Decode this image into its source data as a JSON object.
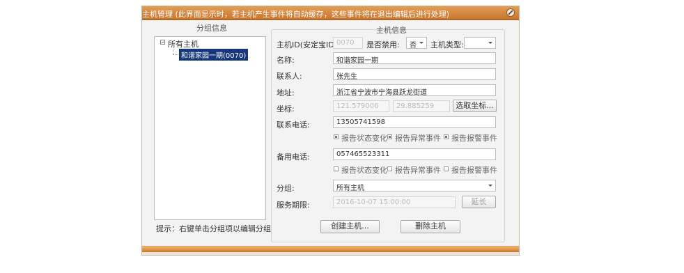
{
  "window": {
    "title": "主机管理  (此界面显示时，若主机产生事件将自动缓存，这些事件将在退出编辑后进行处理)",
    "close_icon": "close-icon"
  },
  "group_panel": {
    "legend": "分组信息",
    "tree": {
      "root_label": "所有主机",
      "child_label": "和谐家园一期(0070)"
    },
    "hint": "提示：右键单击分组项以编辑分组"
  },
  "host_info": {
    "legend": "主机信息",
    "host_id_label": "主机ID(安定宝ID):",
    "host_id_value": "0070",
    "disabled_label": "是否禁用:",
    "disabled_value": "否",
    "host_type_label": "主机类型:",
    "host_type_value": "",
    "name_label": "名称:",
    "name_value": "和谐家园一期",
    "contact_label": "联系人:",
    "contact_value": "张先生",
    "address_label": "地址:",
    "address_value": "浙江省宁波市宁海县跃龙街道",
    "coord_label": "坐标:",
    "coord_lng": "121.579006",
    "coord_lat": "29.885259",
    "pick_coord_button": "选取坐标...",
    "phone_label": "联系电话:",
    "phone_value": "13505741598",
    "phone_options": [
      {
        "label": "报告状态变化",
        "checked": true
      },
      {
        "label": "报告异常事件",
        "checked": true
      },
      {
        "label": "报告报警事件",
        "checked": true
      }
    ],
    "backup_phone_label": "备用电话:",
    "backup_phone_value": "057465523311",
    "backup_options": [
      {
        "label": "报告状态变化",
        "checked": false
      },
      {
        "label": "报告异常事件",
        "checked": false
      },
      {
        "label": "报告报警事件",
        "checked": false
      }
    ],
    "group_label": "分组:",
    "group_value": "所有主机",
    "service_label": "服务期限:",
    "service_value": "2016-10-07 15:00:00",
    "extend_button": "延长",
    "create_button": "创建主机...",
    "delete_button": "删除主机"
  },
  "colors": {
    "title_bar": "#d4843c",
    "selection": "#16387a"
  }
}
